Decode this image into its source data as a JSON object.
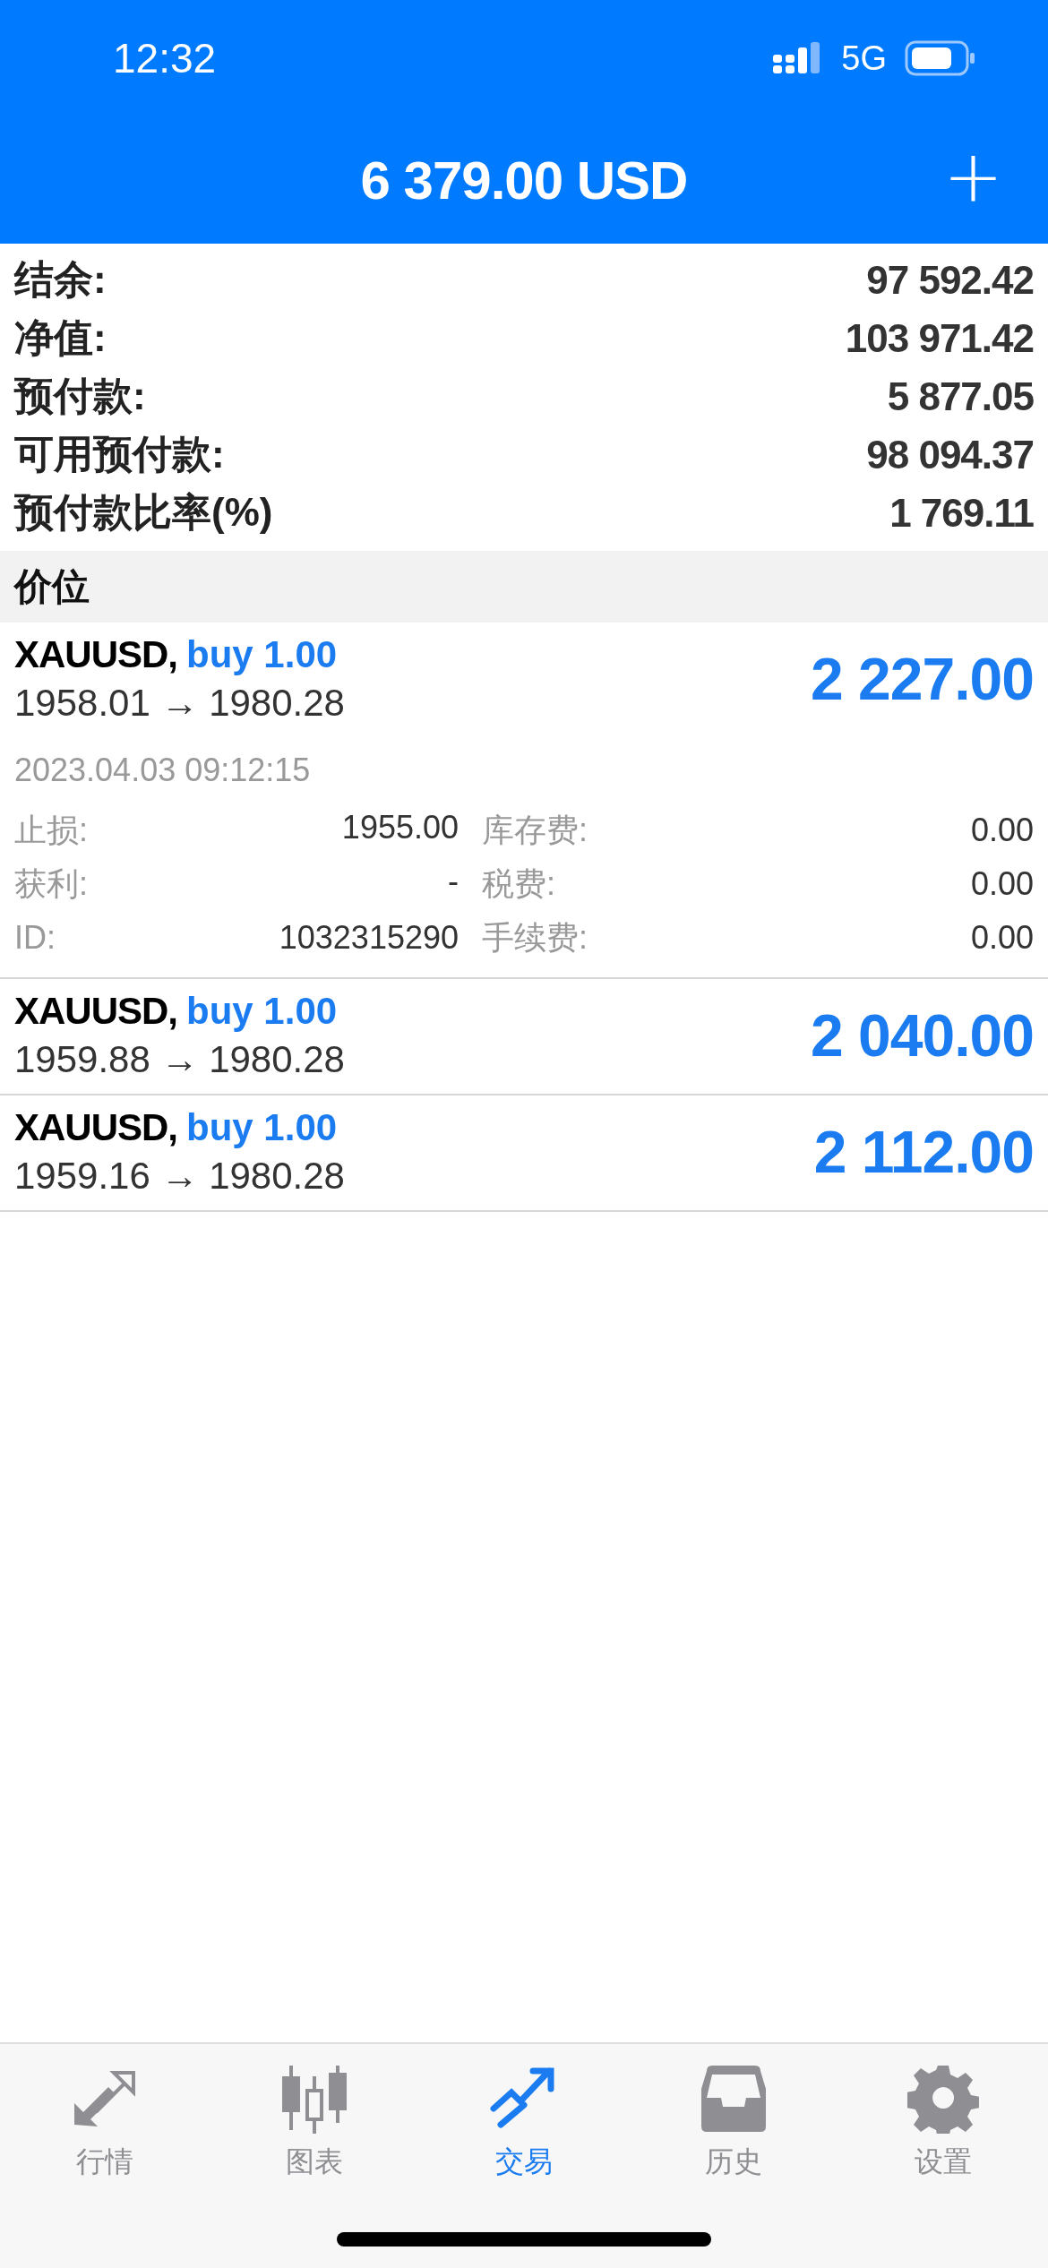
{
  "status_bar": {
    "time": "12:32",
    "network": "5G"
  },
  "header": {
    "title": "6 379.00 USD",
    "add_icon": "+"
  },
  "summary": [
    {
      "label": "结余:",
      "value": "97 592.42"
    },
    {
      "label": "净值:",
      "value": "103 971.42"
    },
    {
      "label": "预付款:",
      "value": "5 877.05"
    },
    {
      "label": "可用预付款:",
      "value": "98 094.37"
    },
    {
      "label": "预付款比率(%)",
      "value": "1 769.11"
    }
  ],
  "section": {
    "title": "价位"
  },
  "positions": [
    {
      "symbol": "XAUUSD,",
      "side": "buy 1.00",
      "prices": "1958.01 → 1980.28",
      "profit": "2 227.00",
      "time": "2023.04.03 09:12:15",
      "details": [
        {
          "label": "止损:",
          "value": "1955.00",
          "label2": "库存费:",
          "value2": "0.00"
        },
        {
          "label": "获利:",
          "value": "-",
          "label2": "税费:",
          "value2": "0.00"
        },
        {
          "label": "ID:",
          "value": "1032315290",
          "label2": "手续费:",
          "value2": "0.00"
        }
      ]
    },
    {
      "symbol": "XAUUSD,",
      "side": "buy 1.00",
      "prices": "1959.88 → 1980.28",
      "profit": "2 040.00"
    },
    {
      "symbol": "XAUUSD,",
      "side": "buy 1.00",
      "prices": "1959.16 → 1980.28",
      "profit": "2 112.00"
    }
  ],
  "tabs": [
    {
      "label": "行情",
      "kind": "quotes",
      "selected": false
    },
    {
      "label": "图表",
      "kind": "chart",
      "selected": false
    },
    {
      "label": "交易",
      "kind": "trade",
      "selected": true
    },
    {
      "label": "历史",
      "kind": "history",
      "selected": false
    },
    {
      "label": "设置",
      "kind": "settings",
      "selected": false
    }
  ]
}
